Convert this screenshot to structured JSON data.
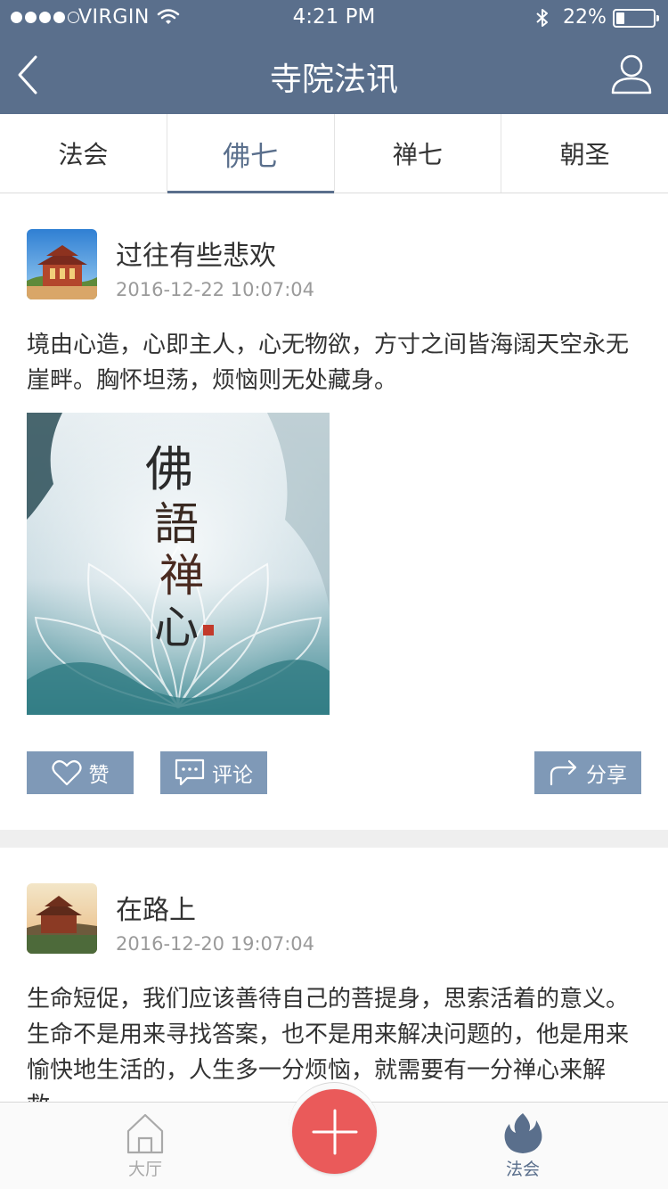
{
  "status_bar": {
    "carrier": "VIRGIN",
    "time": "4:21 PM",
    "battery_text": "22%",
    "battery_level": 0.22
  },
  "nav": {
    "title": "寺院法讯",
    "back_icon": "chevron-left-icon",
    "user_icon": "user-icon"
  },
  "tabs": [
    {
      "label": "法会",
      "active": false
    },
    {
      "label": "佛七",
      "active": true
    },
    {
      "label": "禅七",
      "active": false
    },
    {
      "label": "朝圣",
      "active": false
    }
  ],
  "posts": [
    {
      "title": "过往有些悲欢",
      "time": "2016-12-22 10:07:04",
      "body": "境由心造，心即主人，心无物欲，方寸之间皆海阔天空永无崖畔。胸怀坦荡，烦恼则无处藏身。",
      "image_text": "佛語禅心",
      "actions": {
        "like": "赞",
        "comment": "评论",
        "share": "分享"
      }
    },
    {
      "title": "在路上",
      "time": "2016-12-20 19:07:04",
      "body": "生命短促，我们应该善待自己的菩提身，思索活着的意义。生命不是用来寻找答案，也不是用来解决问题的，他是用来愉快地生活的，人生多一分烦恼，就需要有一分禅心来解救。"
    }
  ],
  "tabbar": {
    "hall_label": "大厅",
    "fahui_label": "法会",
    "add_icon": "plus-icon"
  },
  "colors": {
    "brand": "#5a6f8c",
    "button": "#7f99b7",
    "fab": "#ea5a5a"
  }
}
